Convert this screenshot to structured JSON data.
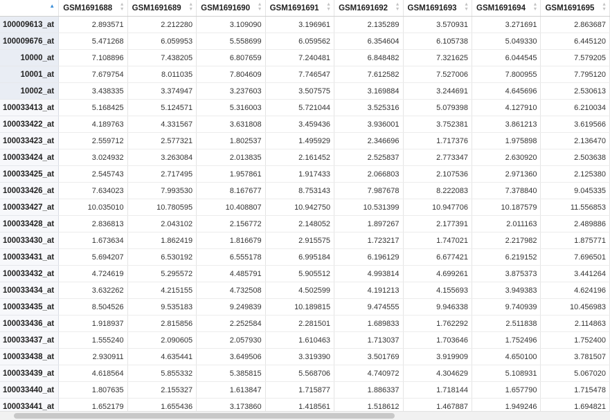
{
  "columns": [
    "GSM1691688",
    "GSM1691689",
    "GSM1691690",
    "GSM1691691",
    "GSM1691692",
    "GSM1691693",
    "GSM1691694",
    "GSM1691695"
  ],
  "rows": [
    {
      "name": "100009613_at",
      "values": [
        "2.893571",
        "2.212280",
        "3.109090",
        "3.196961",
        "2.135289",
        "3.570931",
        "3.271691",
        "2.863687"
      ]
    },
    {
      "name": "100009676_at",
      "values": [
        "5.471268",
        "6.059953",
        "5.558699",
        "6.059562",
        "6.354604",
        "6.105738",
        "5.049330",
        "6.445120"
      ]
    },
    {
      "name": "10000_at",
      "values": [
        "7.108896",
        "7.438205",
        "6.807659",
        "7.240481",
        "6.848482",
        "7.321625",
        "6.044545",
        "7.579205"
      ]
    },
    {
      "name": "10001_at",
      "values": [
        "7.679754",
        "8.011035",
        "7.804609",
        "7.746547",
        "7.612582",
        "7.527006",
        "7.800955",
        "7.795120"
      ]
    },
    {
      "name": "10002_at",
      "values": [
        "3.438335",
        "3.374947",
        "3.237603",
        "3.507575",
        "3.169884",
        "3.244691",
        "4.645696",
        "2.530613"
      ]
    },
    {
      "name": "100033413_at",
      "values": [
        "5.168425",
        "5.124571",
        "5.316003",
        "5.721044",
        "3.525316",
        "5.079398",
        "4.127910",
        "6.210034"
      ]
    },
    {
      "name": "100033422_at",
      "values": [
        "4.189763",
        "4.331567",
        "3.631808",
        "3.459436",
        "3.936001",
        "3.752381",
        "3.861213",
        "3.619566"
      ]
    },
    {
      "name": "100033423_at",
      "values": [
        "2.559712",
        "2.577321",
        "1.802537",
        "1.495929",
        "2.346696",
        "1.717376",
        "1.975898",
        "2.136470"
      ]
    },
    {
      "name": "100033424_at",
      "values": [
        "3.024932",
        "3.263084",
        "2.013835",
        "2.161452",
        "2.525837",
        "2.773347",
        "2.630920",
        "2.503638"
      ]
    },
    {
      "name": "100033425_at",
      "values": [
        "2.545743",
        "2.717495",
        "1.957861",
        "1.917433",
        "2.066803",
        "2.107536",
        "2.971360",
        "2.125380"
      ]
    },
    {
      "name": "100033426_at",
      "values": [
        "7.634023",
        "7.993530",
        "8.167677",
        "8.753143",
        "7.987678",
        "8.222083",
        "7.378840",
        "9.045335"
      ]
    },
    {
      "name": "100033427_at",
      "values": [
        "10.035010",
        "10.780595",
        "10.408807",
        "10.942750",
        "10.531399",
        "10.947706",
        "10.187579",
        "11.556853"
      ]
    },
    {
      "name": "100033428_at",
      "values": [
        "2.836813",
        "2.043102",
        "2.156772",
        "2.148052",
        "1.897267",
        "2.177391",
        "2.011163",
        "2.489886"
      ]
    },
    {
      "name": "100033430_at",
      "values": [
        "1.673634",
        "1.862419",
        "1.816679",
        "2.915575",
        "1.723217",
        "1.747021",
        "2.217982",
        "1.875771"
      ]
    },
    {
      "name": "100033431_at",
      "values": [
        "5.694207",
        "6.530192",
        "6.555178",
        "6.995184",
        "6.196129",
        "6.677421",
        "6.219152",
        "7.696501"
      ]
    },
    {
      "name": "100033432_at",
      "values": [
        "4.724619",
        "5.295572",
        "4.485791",
        "5.905512",
        "4.993814",
        "4.699261",
        "3.875373",
        "3.441264"
      ]
    },
    {
      "name": "100033434_at",
      "values": [
        "3.632262",
        "4.215155",
        "4.732508",
        "4.502599",
        "4.191213",
        "4.155693",
        "3.949383",
        "4.624196"
      ]
    },
    {
      "name": "100033435_at",
      "values": [
        "8.504526",
        "9.535183",
        "9.249839",
        "10.189815",
        "9.474555",
        "9.946338",
        "9.740939",
        "10.456983"
      ]
    },
    {
      "name": "100033436_at",
      "values": [
        "1.918937",
        "2.815856",
        "2.252584",
        "2.281501",
        "1.689833",
        "1.762292",
        "2.511838",
        "2.114863"
      ]
    },
    {
      "name": "100033437_at",
      "values": [
        "1.555240",
        "2.090605",
        "2.057930",
        "1.610463",
        "1.713037",
        "1.703646",
        "1.752496",
        "1.752400"
      ]
    },
    {
      "name": "100033438_at",
      "values": [
        "2.930911",
        "4.635441",
        "3.649506",
        "3.319390",
        "3.501769",
        "3.919909",
        "4.650100",
        "3.781507"
      ]
    },
    {
      "name": "100033439_at",
      "values": [
        "4.618564",
        "5.855332",
        "5.385815",
        "5.568706",
        "4.740972",
        "4.304629",
        "5.108931",
        "5.067020"
      ]
    },
    {
      "name": "100033440_at",
      "values": [
        "1.807635",
        "2.155327",
        "1.613847",
        "1.715877",
        "1.886337",
        "1.718144",
        "1.657790",
        "1.715478"
      ]
    },
    {
      "name": "100033441_at",
      "values": [
        "1.652179",
        "1.655436",
        "3.173860",
        "1.418561",
        "1.518612",
        "1.467887",
        "1.949246",
        "1.694821"
      ]
    }
  ],
  "icons": {
    "sort_active": "sort-ascending-icon",
    "sort_inactive": "sort-icon"
  },
  "colors": {
    "accent": "#3d8fd8",
    "row_header_bg": "#f7f8fb"
  }
}
